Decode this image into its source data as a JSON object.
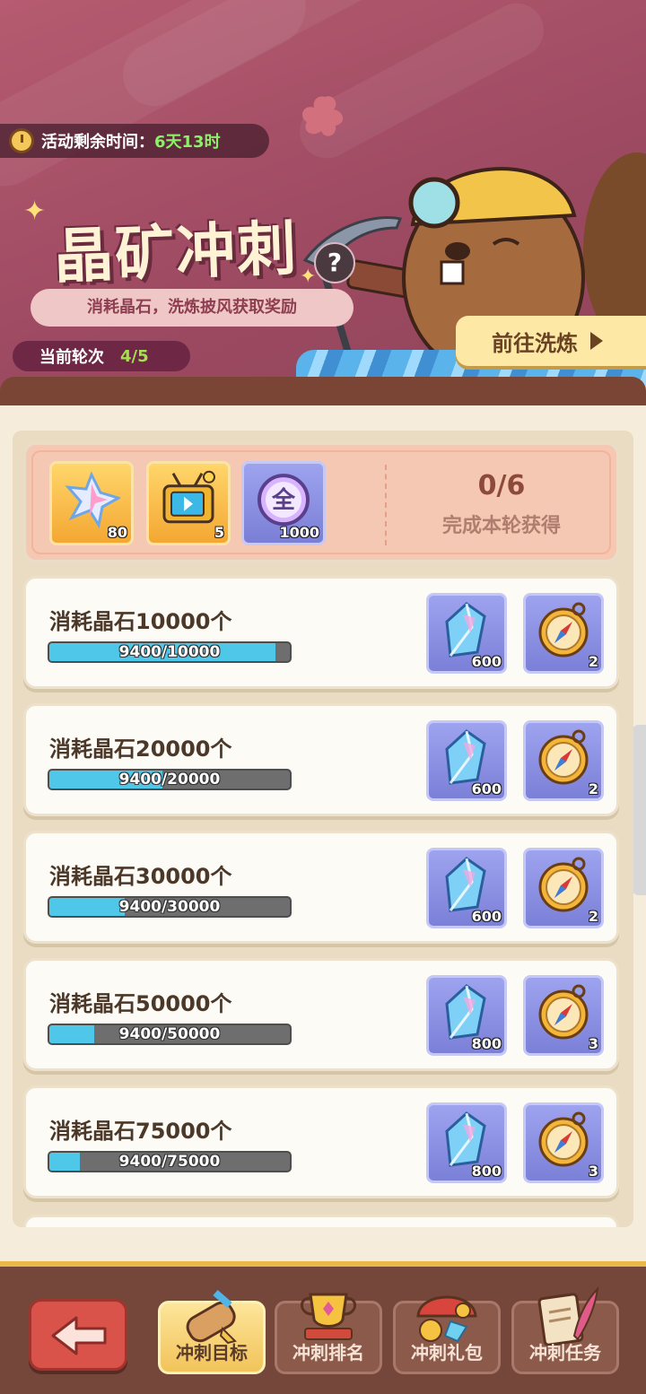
{
  "banner": {
    "timer_label": "活动剩余时间：",
    "timer_value": "6天13时",
    "title": "晶矿冲刺",
    "help_icon": "?",
    "subtitle": "消耗晶石，洗炼披风获取奖励",
    "round_label": "当前轮次",
    "round_value": "4/5",
    "goto_label": "前往洗炼"
  },
  "round_rewards": {
    "items": [
      {
        "icon": "star-crystal-icon",
        "count": "80"
      },
      {
        "icon": "tv-box-icon",
        "count": "5"
      },
      {
        "icon": "all-orb-icon",
        "glyph": "全",
        "count": "1000"
      }
    ],
    "progress": "0/6",
    "progress_label": "完成本轮获得"
  },
  "tasks": [
    {
      "name": "消耗晶石10000个",
      "progress_text": "9400/10000",
      "fraction": 0.94,
      "rewards": [
        {
          "icon": "crystal-icon",
          "count": "600"
        },
        {
          "icon": "compass-icon",
          "count": "2"
        }
      ]
    },
    {
      "name": "消耗晶石20000个",
      "progress_text": "9400/20000",
      "fraction": 0.47,
      "rewards": [
        {
          "icon": "crystal-icon",
          "count": "600"
        },
        {
          "icon": "compass-icon",
          "count": "2"
        }
      ]
    },
    {
      "name": "消耗晶石30000个",
      "progress_text": "9400/30000",
      "fraction": 0.313,
      "rewards": [
        {
          "icon": "crystal-icon",
          "count": "600"
        },
        {
          "icon": "compass-icon",
          "count": "2"
        }
      ]
    },
    {
      "name": "消耗晶石50000个",
      "progress_text": "9400/50000",
      "fraction": 0.188,
      "rewards": [
        {
          "icon": "crystal-icon",
          "count": "800"
        },
        {
          "icon": "compass-icon",
          "count": "3"
        }
      ]
    },
    {
      "name": "消耗晶石75000个",
      "progress_text": "9400/75000",
      "fraction": 0.125,
      "rewards": [
        {
          "icon": "crystal-icon",
          "count": "800"
        },
        {
          "icon": "compass-icon",
          "count": "3"
        }
      ]
    }
  ],
  "nav": {
    "back_icon": "arrow-left-icon",
    "tabs": [
      {
        "label": "冲刺目标",
        "icon": "scroll-icon",
        "active": true
      },
      {
        "label": "冲刺排名",
        "icon": "trophy-icon",
        "active": false
      },
      {
        "label": "冲刺礼包",
        "icon": "gift-pile-icon",
        "active": false
      },
      {
        "label": "冲刺任务",
        "icon": "quest-scroll-icon",
        "active": false
      }
    ]
  },
  "colors": {
    "banner": "#a5506a",
    "progress_fill": "#4fc7e8",
    "reward_bg": "#8a8fe0",
    "accent_gold": "#f2c35a"
  }
}
